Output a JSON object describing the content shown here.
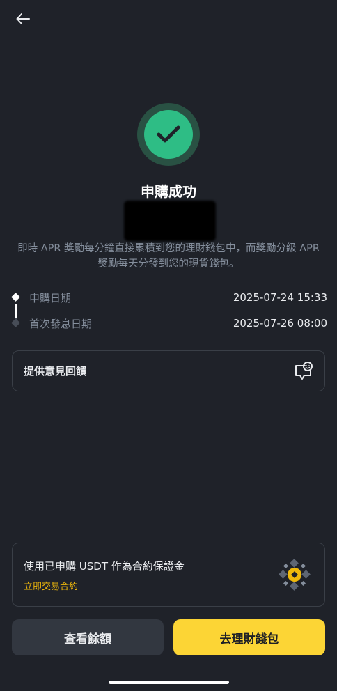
{
  "header": {
    "back_icon": "arrow-left-icon"
  },
  "result": {
    "status_icon": "check-icon",
    "title": "申購成功",
    "amount": "",
    "description": "即時 APR 獎勵每分鐘直接累積到您的理財錢包中，而獎勵分級 APR 獎勵每天分發到您的現貨錢包。"
  },
  "timeline": [
    {
      "label": "申購日期",
      "value": "2025-07-24 15:33"
    },
    {
      "label": "首次發息日期",
      "value": "2025-07-26 08:00"
    }
  ],
  "feedback": {
    "label": "提供意見回饋",
    "icon": "feedback-smile-icon"
  },
  "promo": {
    "text": "使用已申購 USDT 作為合約保證金",
    "link": "立即交易合約",
    "icon": "binance-futures-icon"
  },
  "actions": {
    "secondary_label": "查看餘額",
    "primary_label": "去理財錢包"
  },
  "colors": {
    "background": "#1f2229",
    "success": "#2ebd85",
    "brand_yellow": "#fcd535",
    "link_yellow": "#f0b90b"
  }
}
